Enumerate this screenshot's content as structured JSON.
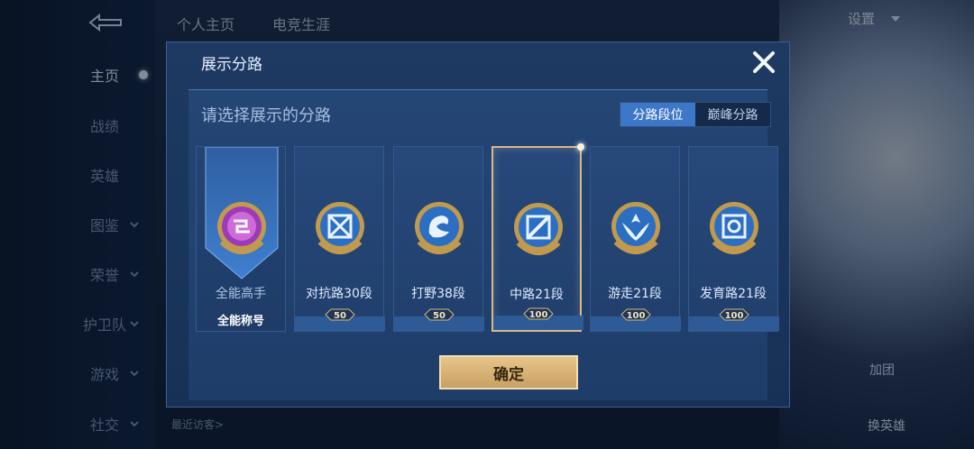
{
  "background": {
    "nav": [
      "主页",
      "战绩",
      "英雄",
      "图鉴",
      "荣誉",
      "护卫队",
      "游戏",
      "社交"
    ],
    "top_tabs": [
      "个人主页",
      "电竞生涯"
    ],
    "settings": "设置",
    "right_links": [
      "加团",
      "换英雄"
    ],
    "recent_visitors": "最近访客>"
  },
  "dialog": {
    "title": "展示分路",
    "subtitle": "请选择展示的分路",
    "toggle": [
      "分路段位",
      "巅峰分路"
    ],
    "cards": [
      {
        "name": "全能高手",
        "title": "全能称号"
      },
      {
        "name": "对抗路30段",
        "badge": "50",
        "icon": "clash-lane-icon"
      },
      {
        "name": "打野38段",
        "badge": "50",
        "icon": "jungle-dragon-icon"
      },
      {
        "name": "中路21段",
        "badge": "100",
        "icon": "mid-lane-icon",
        "selected": true
      },
      {
        "name": "游走21段",
        "badge": "100",
        "icon": "roam-icon"
      },
      {
        "name": "发育路21段",
        "badge": "100",
        "icon": "farm-lane-icon"
      }
    ],
    "confirm": "确定",
    "colors": {
      "accent": "#3d78c8",
      "gold": "#c8a064",
      "purple": "#9b3bb8"
    }
  }
}
